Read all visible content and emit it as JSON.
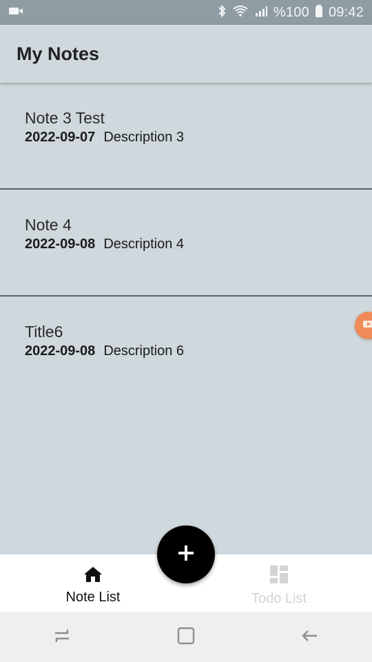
{
  "status_bar": {
    "battery_text": "%100",
    "time": "09:42"
  },
  "app_bar": {
    "title": "My Notes"
  },
  "notes": [
    {
      "title": "Note 3 Test",
      "date": "2022-09-07",
      "description": "Description 3"
    },
    {
      "title": "Note 4",
      "date": "2022-09-08",
      "description": "Description 4"
    },
    {
      "title": "Title6",
      "date": "2022-09-08",
      "description": "Description 6"
    }
  ],
  "fab": {
    "icon": "plus-icon"
  },
  "bottom_nav": {
    "items": [
      {
        "label": "Note List",
        "icon": "home-icon",
        "active": true
      },
      {
        "label": "Todo List",
        "icon": "dashboard-icon",
        "active": false
      }
    ]
  },
  "colors": {
    "app_background": "#cfd8dc",
    "status_bar": "#8f9ca3",
    "fab": "#000000",
    "inactive_tab": "#d4d4d4",
    "bubble": "#f08a56"
  }
}
